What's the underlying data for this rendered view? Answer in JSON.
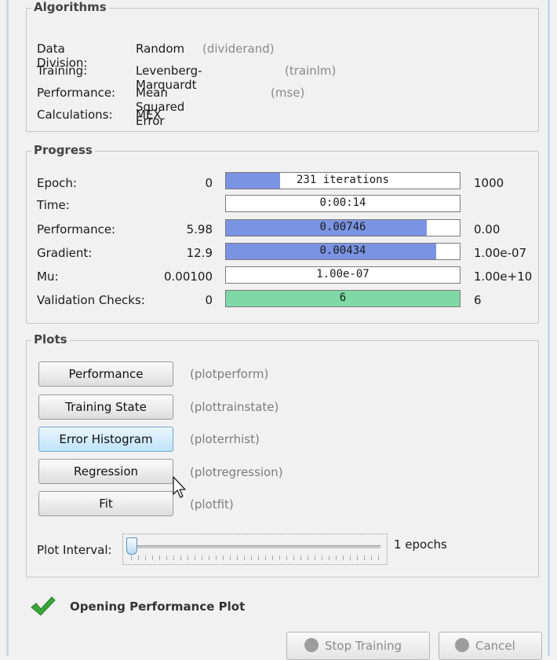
{
  "algorithms": {
    "title": "Algorithms",
    "rows": [
      {
        "label": "Data Division:",
        "value": "Random",
        "fn": "(dividerand)"
      },
      {
        "label": "Training:",
        "value": "Levenberg-Marquardt",
        "fn": "(trainlm)"
      },
      {
        "label": "Performance:",
        "value": "Mean Squared Error",
        "fn": "(mse)"
      },
      {
        "label": "Calculations:",
        "value": "MEX",
        "fn": ""
      }
    ]
  },
  "progress": {
    "title": "Progress",
    "rows": [
      {
        "label": "Epoch:",
        "start": "0",
        "bar": "231 iterations",
        "end": "1000",
        "fraction": 0.23
      },
      {
        "label": "Time:",
        "start": "",
        "bar": "0:00:14",
        "end": "",
        "fraction": 0
      },
      {
        "label": "Performance:",
        "start": "5.98",
        "bar": "0.00746",
        "end": "0.00",
        "fraction": 0.86
      },
      {
        "label": "Gradient:",
        "start": "12.9",
        "bar": "0.00434",
        "end": "1.00e-07",
        "fraction": 0.9
      },
      {
        "label": "Mu:",
        "start": "0.00100",
        "bar": "1.00e-07",
        "end": "1.00e+10",
        "fraction": 0
      },
      {
        "label": "Validation Checks:",
        "start": "0",
        "bar": "6",
        "end": "6",
        "fraction": 1.0
      }
    ]
  },
  "plots": {
    "title": "Plots",
    "buttons": [
      {
        "label": "Performance",
        "fn": "(plotperform)"
      },
      {
        "label": "Training State",
        "fn": "(plottrainstate)"
      },
      {
        "label": "Error Histogram",
        "fn": "(ploterrhist)"
      },
      {
        "label": "Regression",
        "fn": "(plotregression)"
      },
      {
        "label": "Fit",
        "fn": "(plotfit)"
      }
    ],
    "interval_label": "Plot Interval:",
    "interval_value": "1 epochs"
  },
  "status": {
    "text": "Opening Performance Plot",
    "icon": "check-icon",
    "color": "#3aa53a"
  },
  "footer": {
    "stop_label": "Stop Training",
    "cancel_label": "Cancel"
  },
  "colors": {
    "bar_blue": "#7b93e3",
    "bar_green": "#7fd9a6",
    "highlight_button": "#bfe3f8"
  }
}
